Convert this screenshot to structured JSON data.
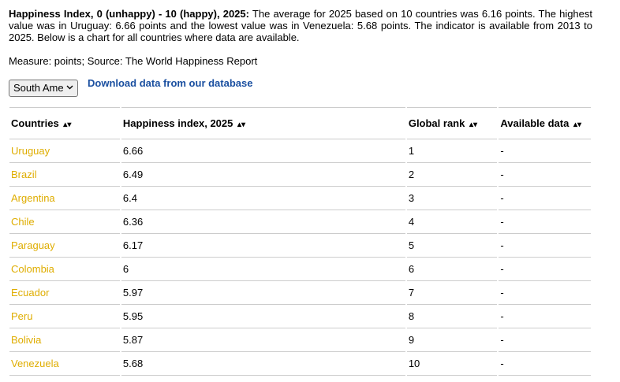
{
  "description": {
    "bold_lead": "Happiness Index, 0 (unhappy) - 10 (happy), 2025:",
    "text": " The average for 2025 based on 10 countries was 6.16 points. The highest value was in Uruguay: 6.66 points and the lowest value was in Venezuela: 5.68 points. The indicator is available from 2013 to 2025. Below is a chart for all countries where data are available."
  },
  "measure_line": "Measure: points; Source: The World Happiness Report",
  "region_select": {
    "selected": "South America",
    "icon": "chevron-down-icon"
  },
  "download_link": "Download data from our database",
  "table": {
    "headers": [
      {
        "label": "Countries",
        "sort": "▴▾"
      },
      {
        "label": "Happiness index, 2025",
        "sort": "▴▾"
      },
      {
        "label": "Global rank",
        "sort": "▴▾"
      },
      {
        "label": "Available data",
        "sort": "▴▾"
      }
    ],
    "rows": [
      {
        "country": "Uruguay",
        "value": "6.66",
        "rank": "1",
        "available": "-"
      },
      {
        "country": "Brazil",
        "value": "6.49",
        "rank": "2",
        "available": "-"
      },
      {
        "country": "Argentina",
        "value": "6.4",
        "rank": "3",
        "available": "-"
      },
      {
        "country": "Chile",
        "value": "6.36",
        "rank": "4",
        "available": "-"
      },
      {
        "country": "Paraguay",
        "value": "6.17",
        "rank": "5",
        "available": "-"
      },
      {
        "country": "Colombia",
        "value": "6",
        "rank": "6",
        "available": "-"
      },
      {
        "country": "Ecuador",
        "value": "5.97",
        "rank": "7",
        "available": "-"
      },
      {
        "country": "Peru",
        "value": "5.95",
        "rank": "8",
        "available": "-"
      },
      {
        "country": "Bolivia",
        "value": "5.87",
        "rank": "9",
        "available": "-"
      },
      {
        "country": "Venezuela",
        "value": "5.68",
        "rank": "10",
        "available": "-"
      }
    ]
  },
  "colors": {
    "link_blue": "#1a4fa0",
    "country_gold": "#dfad00",
    "rule_gray": "#cccccc"
  }
}
